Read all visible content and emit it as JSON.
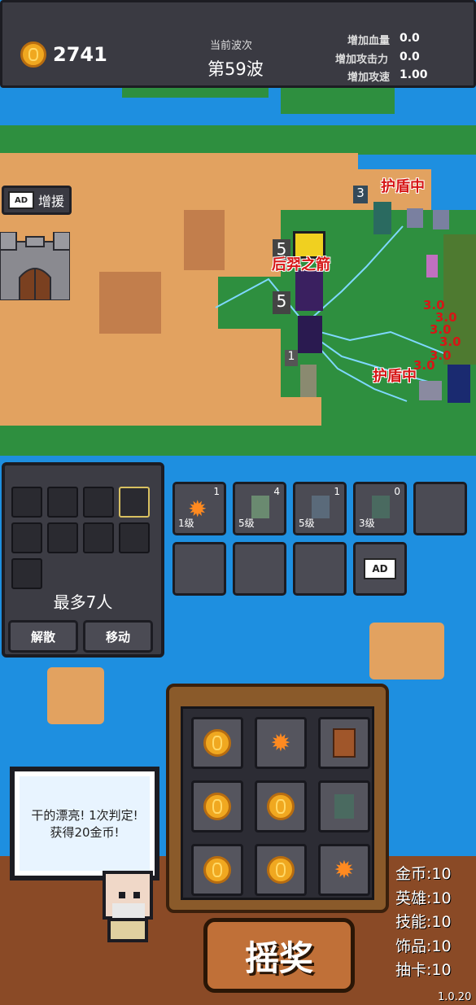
{
  "hud": {
    "gold": "2741",
    "wave_caption": "当前波次",
    "wave": "第59波",
    "stats": [
      {
        "label": "增加血量",
        "value": "0.0"
      },
      {
        "label": "增加攻击力",
        "value": "0.0"
      },
      {
        "label": "增加攻速",
        "value": "1.00"
      }
    ]
  },
  "map": {
    "reinforce": {
      "badge": "AD",
      "label": "增援"
    },
    "floating": {
      "shield_top": "护盾中",
      "shield_bottom": "护盾中",
      "skill_name": "后羿之箭",
      "level_5a": "5",
      "level_5b": "5",
      "level_3": "3",
      "level_1": "1",
      "damage": [
        "3.0",
        "3.0",
        "3.0",
        "3.0",
        "3.0",
        "3.0"
      ]
    }
  },
  "hero_panel": {
    "max_text": "最多7人",
    "disband": "解散",
    "move": "移动"
  },
  "skills": [
    {
      "icon": "fireball-icon",
      "count": "1",
      "level": "1级"
    },
    {
      "icon": "archer-hero-icon",
      "count": "4",
      "level": "5级"
    },
    {
      "icon": "mage-hero-icon",
      "count": "1",
      "level": "5级"
    },
    {
      "icon": "knight-hero-icon",
      "count": "0",
      "level": "3级"
    }
  ],
  "ad_slot_badge": "AD",
  "slot_machine": {
    "reels": [
      "coin",
      "fire",
      "chest",
      "coin",
      "coin",
      "knight",
      "coin",
      "coin",
      "fire"
    ],
    "spin_label": "摇奖"
  },
  "dialog": {
    "text": "干的漂亮! 1次判定! 获得20金币!"
  },
  "odds": [
    {
      "label": "金币",
      "value": "10"
    },
    {
      "label": "英雄",
      "value": "10"
    },
    {
      "label": "技能",
      "value": "10"
    },
    {
      "label": "饰品",
      "value": "10"
    },
    {
      "label": "抽卡",
      "value": "10"
    }
  ],
  "odds_text": [
    "金币:10",
    "英雄:10",
    "技能:10",
    "饰品:10",
    "抽卡:10"
  ],
  "version": "1.0.20",
  "colors": {
    "accent_gold": "#f0a820",
    "damage_red": "#d61616",
    "lightning": "#7fd8ff"
  }
}
